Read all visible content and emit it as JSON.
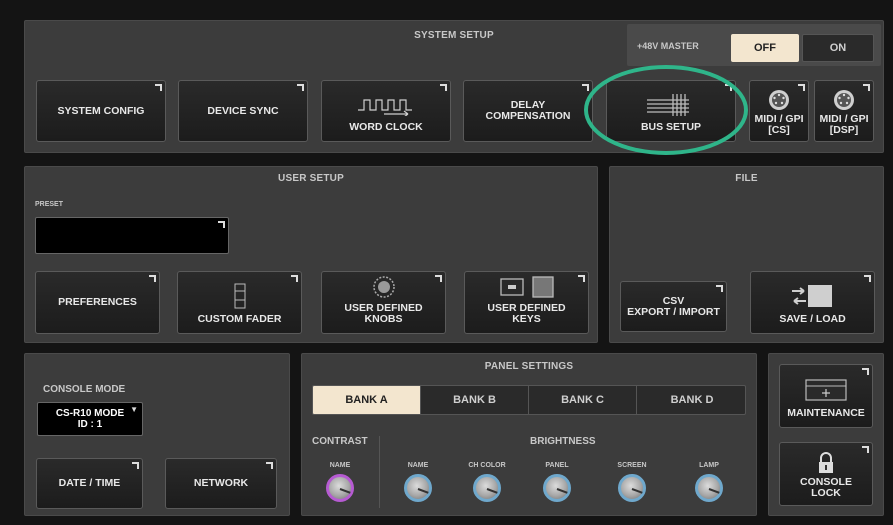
{
  "system_setup": {
    "title": "SYSTEM SETUP",
    "phantom": {
      "label": "+48V MASTER",
      "off": "OFF",
      "on": "ON",
      "selected": "OFF"
    },
    "buttons": {
      "system_config": "SYSTEM CONFIG",
      "device_sync": "DEVICE SYNC",
      "word_clock": "WORD CLOCK",
      "delay_comp_line1": "DELAY",
      "delay_comp_line2": "COMPENSATION",
      "bus_setup": "BUS SETUP",
      "midi_cs_line1": "MIDI / GPI",
      "midi_cs_line2": "[CS]",
      "midi_dsp_line1": "MIDI / GPI",
      "midi_dsp_line2": "[DSP]"
    },
    "highlight_color": "#2fb58a"
  },
  "user_setup": {
    "title": "USER SETUP",
    "preset_label": "PRESET",
    "preset_value": "",
    "buttons": {
      "preferences": "PREFERENCES",
      "custom_fader": "CUSTOM FADER",
      "knobs_line1": "USER DEFINED",
      "knobs_line2": "KNOBS",
      "keys_line1": "USER DEFINED",
      "keys_line2": "KEYS"
    }
  },
  "file": {
    "title": "FILE",
    "csv_line1": "CSV",
    "csv_line2": "EXPORT / IMPORT",
    "save_load": "SAVE / LOAD"
  },
  "console_mode": {
    "title": "CONSOLE MODE",
    "value_line1": "CS-R10 MODE",
    "value_line2": "ID : 1",
    "date_time": "DATE / TIME",
    "network": "NETWORK"
  },
  "panel_settings": {
    "title": "PANEL SETTINGS",
    "banks": [
      "BANK A",
      "BANK B",
      "BANK C",
      "BANK D"
    ],
    "selected_bank": "BANK A",
    "contrast_label": "CONTRAST",
    "brightness_label": "BRIGHTNESS",
    "contrast_knobs": [
      "NAME"
    ],
    "brightness_knobs": [
      "NAME",
      "CH COLOR",
      "PANEL",
      "SCREEN",
      "LAMP"
    ]
  },
  "maintenance": {
    "maintenance": "MAINTENANCE",
    "lock_line1": "CONSOLE",
    "lock_line2": "LOCK"
  }
}
